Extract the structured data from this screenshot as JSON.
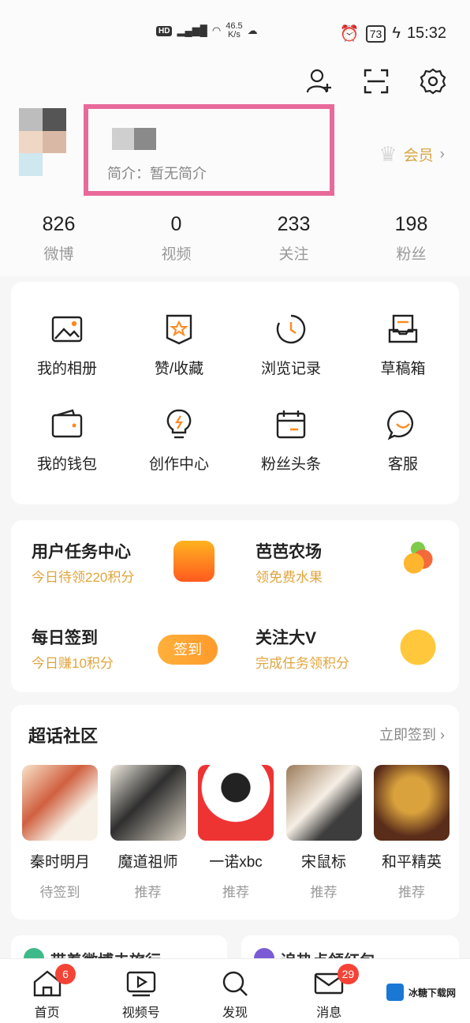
{
  "status_bar": {
    "hd": "HD",
    "net_speed_value": "46.5",
    "net_speed_unit": "K/s",
    "battery": "73",
    "time": "15:32"
  },
  "profile": {
    "bio": "简介：暂无简介",
    "vip_label": "会员",
    "stats": [
      {
        "value": "826",
        "label": "微博"
      },
      {
        "value": "0",
        "label": "视频"
      },
      {
        "value": "233",
        "label": "关注"
      },
      {
        "value": "198",
        "label": "粉丝"
      }
    ]
  },
  "grid_items": [
    {
      "label": "我的相册",
      "icon": "photo-album-icon"
    },
    {
      "label": "赞/收藏",
      "icon": "like-favorite-icon"
    },
    {
      "label": "浏览记录",
      "icon": "history-clock-icon"
    },
    {
      "label": "草稿箱",
      "icon": "drafts-tray-icon"
    },
    {
      "label": "我的钱包",
      "icon": "wallet-icon"
    },
    {
      "label": "创作中心",
      "icon": "lightbulb-icon"
    },
    {
      "label": "粉丝头条",
      "icon": "calendar-icon"
    },
    {
      "label": "客服",
      "icon": "chat-bubble-icon"
    }
  ],
  "tasks": [
    {
      "title": "用户任务中心",
      "sub": "今日待领220积分"
    },
    {
      "title": "芭芭农场",
      "sub": "领免费水果"
    },
    {
      "title": "每日签到",
      "sub": "今日赚10积分",
      "button": "签到"
    },
    {
      "title": "关注大V",
      "sub": "完成任务领积分"
    }
  ],
  "super_topics": {
    "title": "超话社区",
    "action": "立即签到",
    "items": [
      {
        "name": "秦时明月",
        "status": "待签到"
      },
      {
        "name": "魔道祖师",
        "status": "推荐"
      },
      {
        "name": "一诺xbc",
        "status": "推荐"
      },
      {
        "name": "宋鼠标",
        "status": "推荐"
      },
      {
        "name": "和平精英",
        "status": "推荐"
      }
    ]
  },
  "peek_cards": [
    "带着微博去旅行",
    "追热点领红包"
  ],
  "tabbar": [
    {
      "label": "首页",
      "badge": "6"
    },
    {
      "label": "视频号"
    },
    {
      "label": "发现"
    },
    {
      "label": "消息",
      "badge": "29"
    }
  ],
  "watermark": "冰糖下载网"
}
